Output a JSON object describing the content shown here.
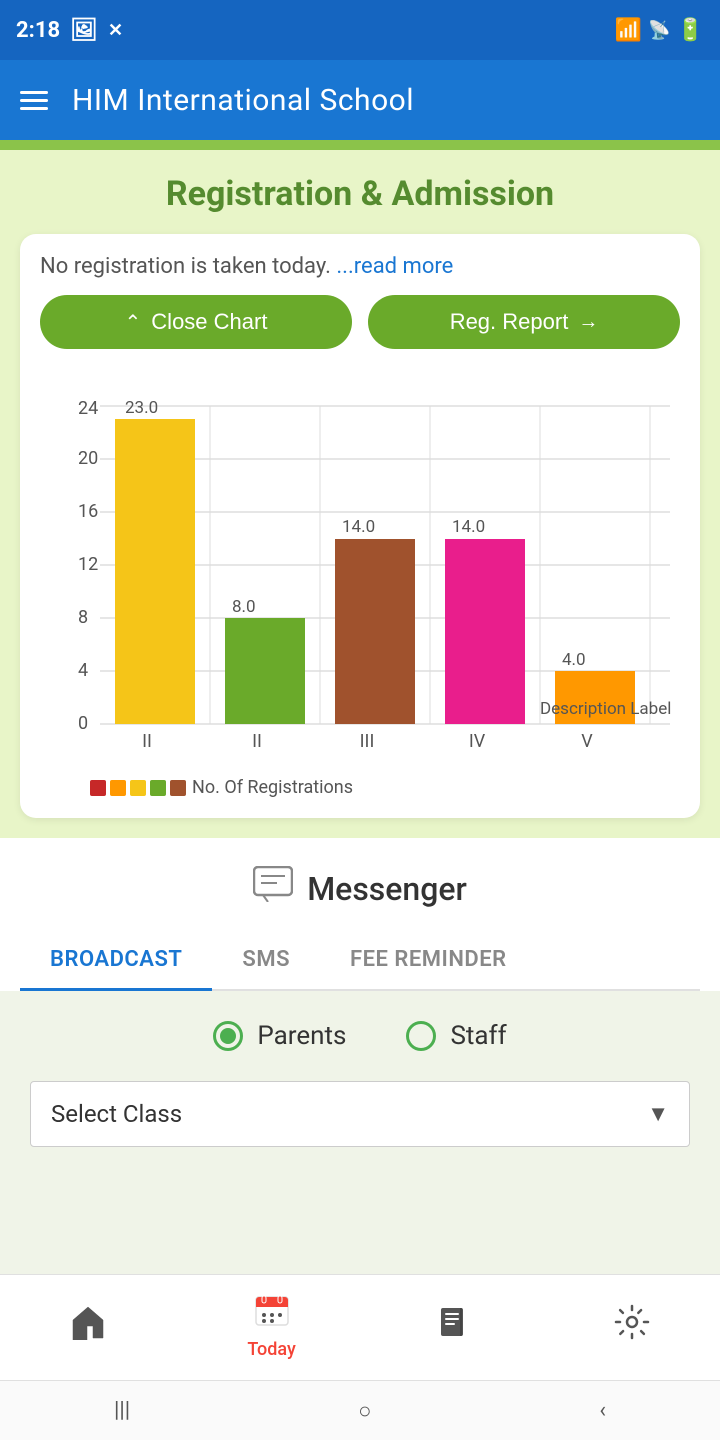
{
  "statusBar": {
    "time": "2:18",
    "wifi": "wifi",
    "signal": "signal",
    "battery": "battery"
  },
  "appBar": {
    "title": "HIM International School",
    "menuIcon": "hamburger-menu-icon"
  },
  "registration": {
    "title": "Registration & Admission",
    "notice": "No registration is taken today.",
    "readMore": "...read more",
    "closeChartLabel": "Close Chart",
    "regReportLabel": "Reg. Report"
  },
  "chart": {
    "yMax": 24,
    "yLabels": [
      0,
      4,
      8,
      12,
      16,
      20,
      24
    ],
    "bars": [
      {
        "label": "II",
        "value": 23.0,
        "color": "#f5c518"
      },
      {
        "label": "II",
        "value": 8.0,
        "color": "#6aaa2a"
      },
      {
        "label": "III",
        "value": 14.0,
        "color": "#a0522d"
      },
      {
        "label": "IV",
        "value": 14.0,
        "color": "#e91e8c"
      },
      {
        "label": "V",
        "value": 4.0,
        "color": "#ff9800"
      }
    ],
    "legendColors": [
      "#c62828",
      "#ff9800",
      "#f5c518",
      "#6aaa2a",
      "#a0522d"
    ],
    "legendLabel": "No. Of Registrations",
    "descriptionLabel": "Description Label"
  },
  "messenger": {
    "title": "Messenger",
    "icon": "messenger-icon",
    "tabs": [
      {
        "id": "broadcast",
        "label": "BROADCAST",
        "active": true
      },
      {
        "id": "sms",
        "label": "SMS",
        "active": false
      },
      {
        "id": "fee-reminder",
        "label": "FEE REMINDER",
        "active": false
      }
    ],
    "radioOptions": [
      {
        "id": "parents",
        "label": "Parents",
        "selected": true
      },
      {
        "id": "staff",
        "label": "Staff",
        "selected": false
      }
    ],
    "selectClassLabel": "Select Class",
    "selectClassPlaceholder": "Select Class"
  },
  "bottomNav": {
    "items": [
      {
        "id": "home",
        "icon": "🏠",
        "label": ""
      },
      {
        "id": "today",
        "icon": "📅",
        "label": "Today",
        "active": true
      },
      {
        "id": "book",
        "icon": "📖",
        "label": ""
      },
      {
        "id": "settings",
        "icon": "⚙️",
        "label": ""
      }
    ]
  },
  "androidNav": {
    "buttons": [
      "|||",
      "○",
      "‹"
    ]
  }
}
